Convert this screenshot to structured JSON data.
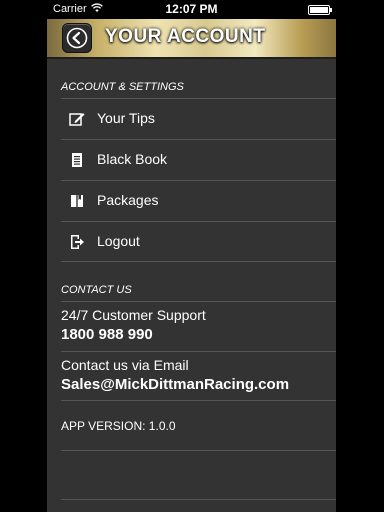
{
  "status_bar": {
    "carrier": "Carrier",
    "time": "12:07 PM"
  },
  "header": {
    "title": "YOUR ACCOUNT",
    "back_icon": "back-arrow-icon"
  },
  "account_section": {
    "title": "ACCOUNT & SETTINGS",
    "items": [
      {
        "label": "Your Tips",
        "icon": "edit-icon"
      },
      {
        "label": "Black Book",
        "icon": "document-icon"
      },
      {
        "label": "Packages",
        "icon": "book-icon"
      },
      {
        "label": "Logout",
        "icon": "logout-icon"
      }
    ]
  },
  "contact_section": {
    "title": "CONTACT US",
    "support_label": "24/7 Customer Support",
    "support_phone": "1800 988 990",
    "email_label": "Contact us via Email",
    "email": "Sales@MickDittmanRacing.com"
  },
  "app_version": "APP VERSION: 1.0.0"
}
